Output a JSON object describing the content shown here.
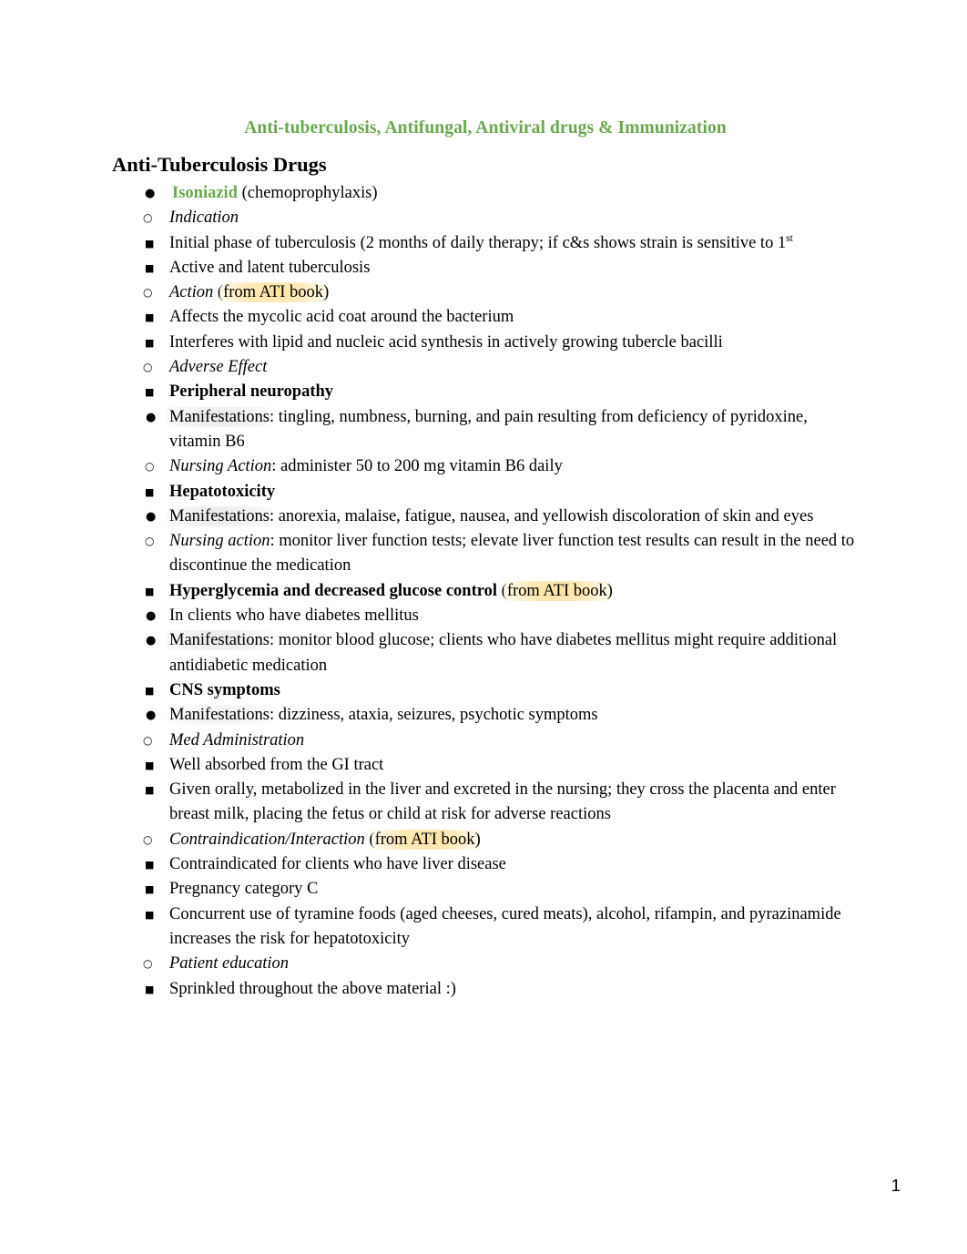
{
  "document": {
    "title": "Anti-tuberculosis, Antifungal, Antiviral drugs & Immunization",
    "heading": "Anti-Tuberculosis Drugs",
    "page_number": "1",
    "title_color": "#6AA84F",
    "highlight_yellow": "#FBE2A0",
    "highlight_gray": "#D6D6D6"
  },
  "bullets": {
    "disc": "●",
    "circle": "○",
    "square": "■"
  },
  "outline": {
    "drug_name": "Isoniazid",
    "drug_suffix": " (chemoprophylaxis)",
    "indication_label": "Indication",
    "indication_1a": "Initial phase of tuberculosis (2 months of daily therapy; if c&s shows strain is sensitive to 1",
    "indication_1b": "st",
    "indication_2": "Active and latent tuberculosis",
    "action_label": "Action",
    "action_open": " (",
    "ati_note": "from ATI book",
    "action_close": ")",
    "action_1": "Affects the mycolic acid coat around the bacterium",
    "action_2": "Interferes with lipid and nucleic acid synthesis in actively growing tubercle bacilli",
    "adverse_label": "Adverse Effect",
    "ae1_title": "Peripheral neuropathy",
    "ae1_manifest_label": "Manifestations",
    "ae1_manifest_text": ": tingling, numbness, burning, and pain resulting from deficiency of pyridoxine, vitamin B6",
    "ae1_nursing_label": "Nursing Action",
    "ae1_nursing_text": ": administer 50 to 200 mg vitamin B6 daily",
    "ae2_title": "Hepatotoxicity",
    "ae2_manifest_label": "Manifestations",
    "ae2_manifest_text": ": anorexia, malaise, fatigue, nausea, and yellowish discoloration of skin and eyes",
    "ae2_nursing_label": "Nursing action",
    "ae2_nursing_text": ": monitor liver function tests; elevate liver function test results can result in the need to discontinue the medication",
    "ae3_title": "Hyperglycemia and decreased glucose control",
    "ae3_sub1": "In clients who have diabetes mellitus",
    "ae3_manifest_label": "Manifestations",
    "ae3_manifest_text": ": monitor blood glucose; clients who have diabetes mellitus might require additional antidiabetic medication",
    "ae4_title": "CNS symptoms",
    "ae4_manifest_label": "Manifestations",
    "ae4_manifest_text": ": dizziness, ataxia, seizures, psychotic symptoms",
    "medadmin_label": "Med Administration",
    "medadmin_1": "Well absorbed from the GI tract",
    "medadmin_2": "Given orally, metabolized in the liver and excreted in the nursing; they cross the placenta and enter breast milk, placing the fetus or child at risk for adverse reactions",
    "contra_label": "Contraindication/Interaction",
    "contra_1": "Contraindicated for clients who have liver disease",
    "contra_2": "Pregnancy category C",
    "contra_3": "Concurrent use of tyramine foods (aged cheeses, cured meats), alcohol, rifampin, and pyrazinamide increases the risk for hepatotoxicity",
    "patiented_label": "Patient education",
    "patiented_1": "Sprinkled throughout the above material :)"
  }
}
